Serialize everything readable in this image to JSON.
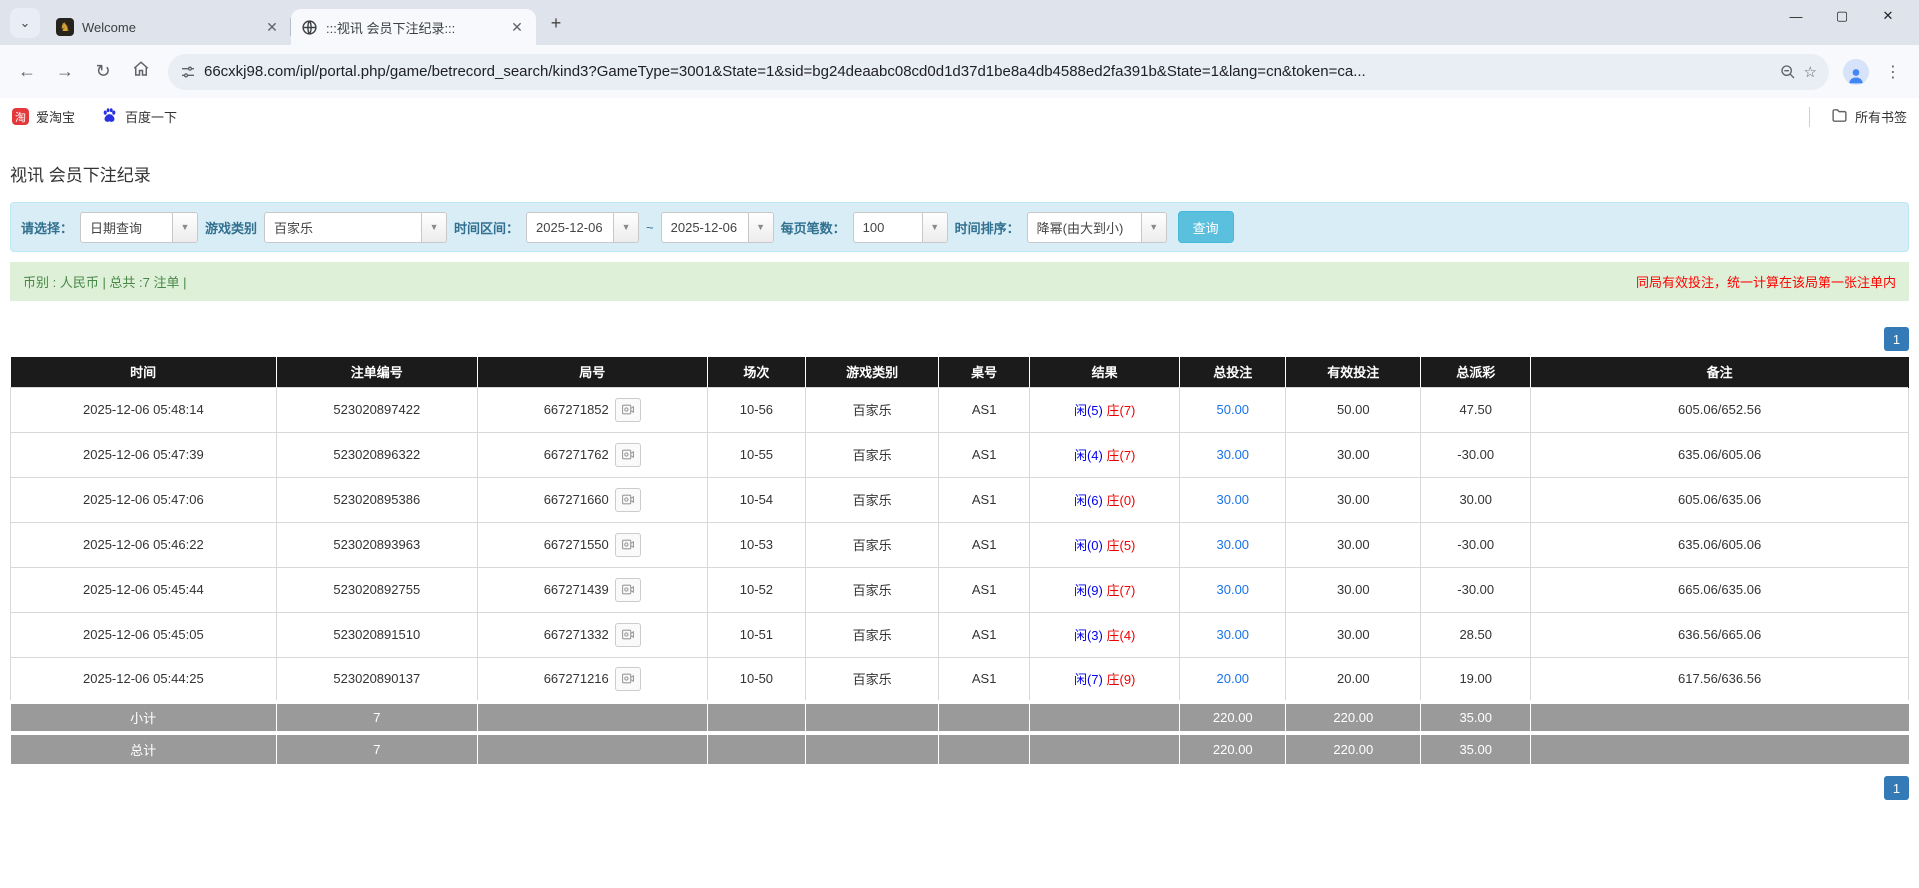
{
  "browser": {
    "tabs": [
      {
        "title": "Welcome"
      },
      {
        "title": ":::视讯 会员下注纪录:::"
      }
    ],
    "url": "66cxkj98.com/ipl/portal.php/game/betrecord_search/kind3?GameType=3001&State=1&sid=bg24deaabc08cd0d1d37d1be8a4db4588ed2fa391b&State=1&lang=cn&token=ca...",
    "bookmarks": [
      {
        "label": "爱淘宝",
        "icon_text": "淘"
      },
      {
        "label": "百度一下"
      }
    ],
    "all_bookmarks_label": "所有书签"
  },
  "page": {
    "title": "视讯 会员下注纪录",
    "filters": {
      "select_label": "请选择：",
      "select_value": "日期查询",
      "game_type_label": "游戏类别",
      "game_type_value": "百家乐",
      "date_range_label": "时间区间：",
      "date_from": "2025-12-06",
      "tilde": "~",
      "date_to": "2025-12-06",
      "page_size_label": "每页笔数：",
      "page_size_value": "100",
      "sort_label": "时间排序：",
      "sort_value": "降幂(由大到小)",
      "search_button": "查询"
    },
    "info_bar": {
      "left": "币别 : 人民币 | 总共 :7 注单 |",
      "right": "同局有效投注，统一计算在该局第一张注单内"
    },
    "pagination": {
      "page": "1"
    },
    "table": {
      "headers": [
        "时间",
        "注单编号",
        "局号",
        "场次",
        "游戏类别",
        "桌号",
        "结果",
        "总投注",
        "有效投注",
        "总派彩",
        "备注"
      ],
      "rows": [
        {
          "time": "2025-12-06 05:48:14",
          "bet_id": "523020897422",
          "round_id": "667271852",
          "session": "10-56",
          "game": "百家乐",
          "table_no": "AS1",
          "result_xian": "闲(5)",
          "result_zhuang": "庄(7)",
          "total_bet": "50.00",
          "valid_bet": "50.00",
          "payout": "47.50",
          "remark": "605.06/652.56"
        },
        {
          "time": "2025-12-06 05:47:39",
          "bet_id": "523020896322",
          "round_id": "667271762",
          "session": "10-55",
          "game": "百家乐",
          "table_no": "AS1",
          "result_xian": "闲(4)",
          "result_zhuang": "庄(7)",
          "total_bet": "30.00",
          "valid_bet": "30.00",
          "payout": "-30.00",
          "remark": "635.06/605.06"
        },
        {
          "time": "2025-12-06 05:47:06",
          "bet_id": "523020895386",
          "round_id": "667271660",
          "session": "10-54",
          "game": "百家乐",
          "table_no": "AS1",
          "result_xian": "闲(6)",
          "result_zhuang": "庄(0)",
          "total_bet": "30.00",
          "valid_bet": "30.00",
          "payout": "30.00",
          "remark": "605.06/635.06"
        },
        {
          "time": "2025-12-06 05:46:22",
          "bet_id": "523020893963",
          "round_id": "667271550",
          "session": "10-53",
          "game": "百家乐",
          "table_no": "AS1",
          "result_xian": "闲(0)",
          "result_zhuang": "庄(5)",
          "total_bet": "30.00",
          "valid_bet": "30.00",
          "payout": "-30.00",
          "remark": "635.06/605.06"
        },
        {
          "time": "2025-12-06 05:45:44",
          "bet_id": "523020892755",
          "round_id": "667271439",
          "session": "10-52",
          "game": "百家乐",
          "table_no": "AS1",
          "result_xian": "闲(9)",
          "result_zhuang": "庄(7)",
          "total_bet": "30.00",
          "valid_bet": "30.00",
          "payout": "-30.00",
          "remark": "665.06/635.06"
        },
        {
          "time": "2025-12-06 05:45:05",
          "bet_id": "523020891510",
          "round_id": "667271332",
          "session": "10-51",
          "game": "百家乐",
          "table_no": "AS1",
          "result_xian": "闲(3)",
          "result_zhuang": "庄(4)",
          "total_bet": "30.00",
          "valid_bet": "30.00",
          "payout": "28.50",
          "remark": "636.56/665.06"
        },
        {
          "time": "2025-12-06 05:44:25",
          "bet_id": "523020890137",
          "round_id": "667271216",
          "session": "10-50",
          "game": "百家乐",
          "table_no": "AS1",
          "result_xian": "闲(7)",
          "result_zhuang": "庄(9)",
          "total_bet": "20.00",
          "valid_bet": "20.00",
          "payout": "19.00",
          "remark": "617.56/636.56"
        }
      ],
      "subtotal": {
        "label": "小计",
        "count": "7",
        "total_bet": "220.00",
        "valid_bet": "220.00",
        "payout": "35.00"
      },
      "total": {
        "label": "总计",
        "count": "7",
        "total_bet": "220.00",
        "valid_bet": "220.00",
        "payout": "35.00"
      }
    },
    "colors": {
      "filter_bg": "#d9edf7",
      "filter_label": "#31708f",
      "info_bg": "#dff0d8",
      "info_text": "#468847",
      "warn_text": "#ff0000",
      "header_bg": "#1b1b1b",
      "sum_bg": "#9a9a9a",
      "page_btn": "#337ab7",
      "search_btn": "#5bc0de",
      "xian_blue": "#0000ee",
      "zhuang_red": "#ee0000",
      "bet_link": "#1a73e8"
    }
  }
}
